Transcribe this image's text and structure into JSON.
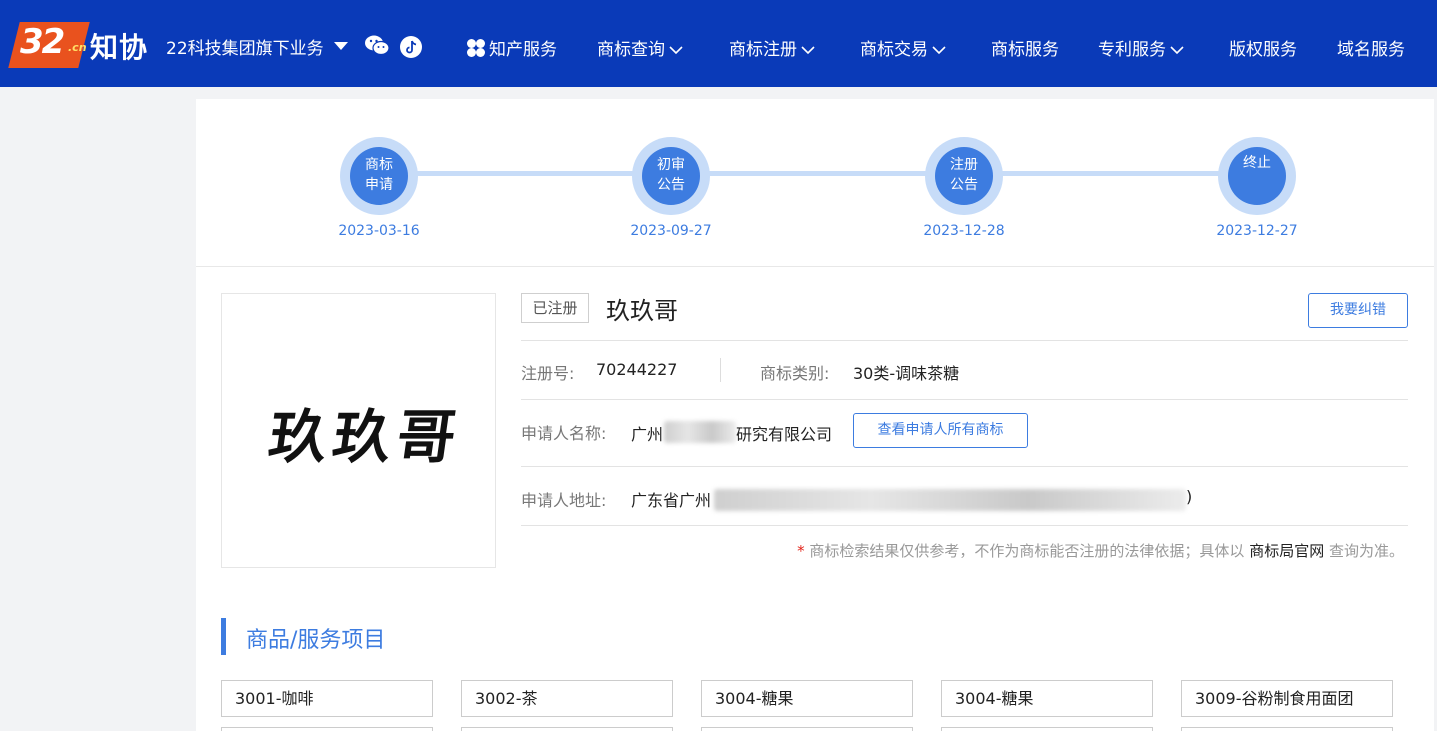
{
  "header": {
    "logo_number": "32",
    "logo_suffix": ".cn",
    "logo_text": "知协",
    "group_label": "22科技集团旗下业务",
    "nav": [
      {
        "label": "知产服务",
        "dropdown": false
      },
      {
        "label": "商标查询",
        "dropdown": true
      },
      {
        "label": "商标注册",
        "dropdown": true
      },
      {
        "label": "商标交易",
        "dropdown": true
      },
      {
        "label": "商标服务",
        "dropdown": false
      },
      {
        "label": "专利服务",
        "dropdown": true
      },
      {
        "label": "版权服务",
        "dropdown": false
      },
      {
        "label": "域名服务",
        "dropdown": false
      }
    ],
    "icons": [
      "wechat-icon",
      "tiktok-icon",
      "clover-icon",
      "chevron-down-icon"
    ]
  },
  "timeline": [
    {
      "line1": "商标",
      "line2": "申请",
      "date": "2023-03-16"
    },
    {
      "line1": "初审",
      "line2": "公告",
      "date": "2023-09-27"
    },
    {
      "line1": "注册",
      "line2": "公告",
      "date": "2023-12-28"
    },
    {
      "line1": "终止",
      "line2": "",
      "date": "2023-12-27"
    }
  ],
  "trademark": {
    "image_text": "玖玖哥",
    "status": "已注册",
    "name": "玖玖哥",
    "report_button": "我要纠错",
    "reg_no_label": "注册号:",
    "reg_no": "70244227",
    "class_label": "商标类别:",
    "class_value": "30类-调味茶糖",
    "applicant_label": "申请人名称:",
    "applicant_prefix": "广州",
    "applicant_suffix": "研究有限公司",
    "view_all_button": "查看申请人所有商标",
    "address_label": "申请人地址:",
    "address_prefix": "广东省广州",
    "address_suffix": ")"
  },
  "disclaimer": {
    "star": "*",
    "text_before": "商标检索结果仅供参考，不作为商标能否注册的法律依据；具体以",
    "link": "商标局官网",
    "text_after": "查询为准。"
  },
  "goods_section": {
    "title": "商品/服务项目",
    "items": [
      "3001-咖啡",
      "3002-茶",
      "3004-糖果",
      "3004-糖果",
      "3009-谷粉制食用面团"
    ]
  },
  "colors": {
    "header_bg": "#0a3ab8",
    "accent": "#3d7ce0",
    "logo_orange": "#e9521e"
  }
}
